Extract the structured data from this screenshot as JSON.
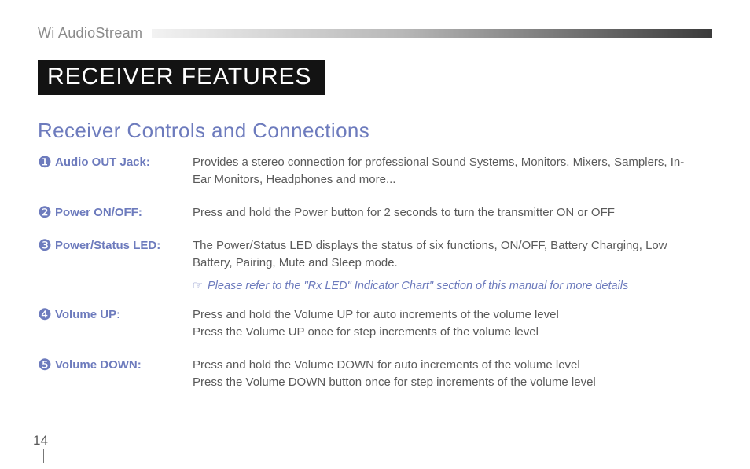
{
  "running_head": "Wi AudioStream",
  "section_title": "RECEIVER FEATURES",
  "subheading": "Receiver Controls and Connections",
  "page_number": "14",
  "note": {
    "icon": "☞",
    "text": "Please refer to the \"Rx LED\" Indicator Chart\" section of this manual for more details"
  },
  "items": [
    {
      "bullet": "❶",
      "label": "Audio OUT Jack:",
      "desc_lines": [
        "Provides a stereo connection for professional Sound Systems, Monitors, Mixers, Samplers, In-Ear Monitors, Headphones and more..."
      ]
    },
    {
      "bullet": "❷",
      "label": "Power ON/OFF:",
      "desc_lines": [
        "Press and hold the Power button for 2 seconds to turn the transmitter ON or OFF"
      ]
    },
    {
      "bullet": "❸",
      "label": "Power/Status LED:",
      "desc_lines": [
        "The Power/Status LED displays the status of six functions, ON/OFF, Battery Charging, Low Battery, Pairing, Mute and Sleep mode."
      ]
    },
    {
      "bullet": "❹",
      "label": "Volume UP:",
      "desc_lines": [
        "Press and hold the Volume UP for auto increments of the volume level",
        "Press the Volume UP once for step increments of the volume level"
      ]
    },
    {
      "bullet": "❺",
      "label": "Volume DOWN:",
      "desc_lines": [
        "Press and hold the Volume DOWN for auto increments of the volume level",
        "Press the Volume DOWN button once for step increments of the volume level"
      ]
    }
  ]
}
